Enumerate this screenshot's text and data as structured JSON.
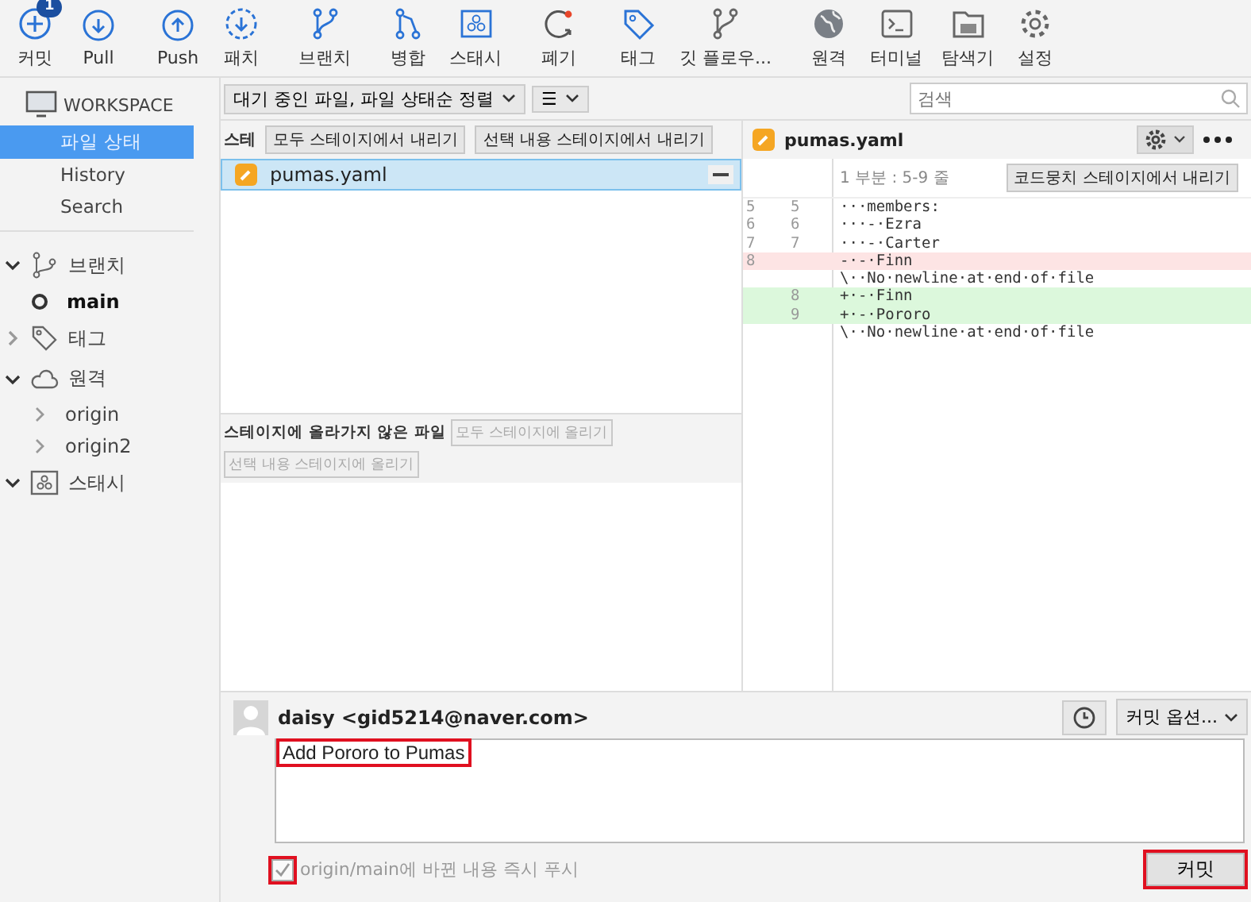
{
  "toolbar": [
    {
      "label": "커밋",
      "badge": "1"
    },
    {
      "label": "Pull"
    },
    {
      "label": "Push"
    },
    {
      "label": "패치"
    },
    {
      "label": "브랜치"
    },
    {
      "label": "병합"
    },
    {
      "label": "스태시"
    },
    {
      "label": "폐기"
    },
    {
      "label": "태그"
    },
    {
      "label": "깃 플로우..."
    },
    {
      "label": "원격"
    },
    {
      "label": "터미널"
    },
    {
      "label": "탐색기"
    },
    {
      "label": "설정"
    }
  ],
  "sidebar": {
    "workspace": {
      "title": "WORKSPACE",
      "items": [
        {
          "label": "파일 상태",
          "selected": true
        },
        {
          "label": "History",
          "selected": false
        },
        {
          "label": "Search",
          "selected": false
        }
      ]
    },
    "groups": [
      {
        "label": "브랜치",
        "expanded": true,
        "children": [
          {
            "label": "main",
            "current": true
          }
        ]
      },
      {
        "label": "태그",
        "expanded": false
      },
      {
        "label": "원격",
        "expanded": true,
        "children": [
          {
            "label": "origin",
            "current": false
          },
          {
            "label": "origin2",
            "current": false
          }
        ]
      },
      {
        "label": "스태시",
        "expanded": true
      }
    ]
  },
  "filter": {
    "sort": "대기 중인 파일, 파일 상태순 정렬",
    "view": "☰"
  },
  "search": {
    "placeholder": "검색"
  },
  "staged": {
    "title": "스테",
    "buttons": [
      {
        "label": "모두 스테이지에서 내리기",
        "disabled": false
      },
      {
        "label": "선택 내용 스테이지에서 내리기",
        "disabled": false
      }
    ],
    "files": [
      {
        "name": "pumas.yaml",
        "selected": true
      }
    ]
  },
  "unstaged": {
    "title": "스테이지에 올라가지 않은 파일",
    "buttons": [
      {
        "label": "모두 스테이지에 올리기",
        "disabled": true
      },
      {
        "label": "선택 내용 스테이지에 올리기",
        "disabled": true
      }
    ]
  },
  "diff": {
    "file": "pumas.yaml",
    "hunk": "1 부분 : 5-9 줄",
    "hunk_button": "코드뭉치 스테이지에서 내리기",
    "lines": [
      {
        "kind": "context",
        "old": "5",
        "new": "5",
        "text": "···members:"
      },
      {
        "kind": "context",
        "old": "6",
        "new": "6",
        "text": "···-·Ezra"
      },
      {
        "kind": "context",
        "old": "7",
        "new": "7",
        "text": "···-·Carter"
      },
      {
        "kind": "removed",
        "old": "8",
        "text": "-·-·Finn"
      },
      {
        "kind": "context",
        "text": "\\··No·newline·at·end·of·file"
      },
      {
        "kind": "added",
        "new": "8",
        "text": "+·-·Finn"
      },
      {
        "kind": "added",
        "new": "9",
        "text": "+·-·Pororo"
      },
      {
        "kind": "context",
        "text": "\\··No·newline·at·end·of·file"
      }
    ]
  },
  "commit": {
    "author": "daisy <gid5214@naver.com>",
    "options": "커밋 옵션...",
    "message": "Add Pororo to Pumas",
    "message_highlighted": true,
    "push": {
      "label": "origin/main에 바뀐 내용 즉시 푸시",
      "checked": true,
      "disabled": true,
      "highlighted": true
    },
    "button": {
      "label": "커밋",
      "highlighted": true
    }
  }
}
